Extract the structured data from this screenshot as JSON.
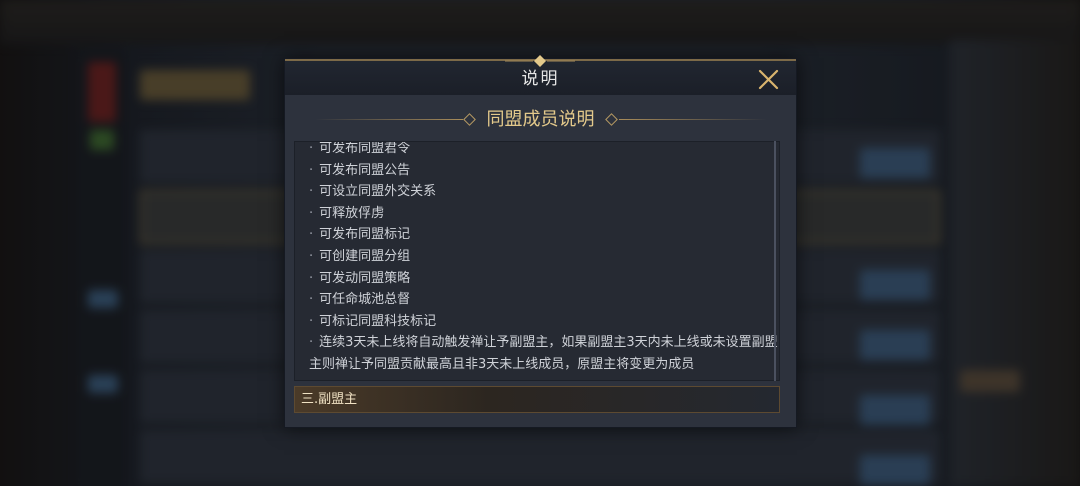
{
  "dialog": {
    "title": "说明",
    "close_icon": "close-icon"
  },
  "section": {
    "title": "同盟成员说明"
  },
  "content": {
    "bullet_marker": "·",
    "items": [
      "可发布同盟君令",
      "可发布同盟公告",
      "可设立同盟外交关系",
      "可释放俘虏",
      "可发布同盟标记",
      "可创建同盟分组",
      "可发动同盟策略",
      "可任命城池总督",
      "可标记同盟科技标记",
      "连续3天未上线将自动触发禅让予副盟主，如果副盟主3天内未上线或未设置副盟主则禅让予同盟贡献最高且非3天未上线成员，原盟主将变更为成员"
    ]
  },
  "subsection": {
    "label": "三.副盟主"
  },
  "colors": {
    "accent_gold": "#e3c98b",
    "dialog_bg": "#2d323d",
    "text": "#cfd2d8"
  }
}
